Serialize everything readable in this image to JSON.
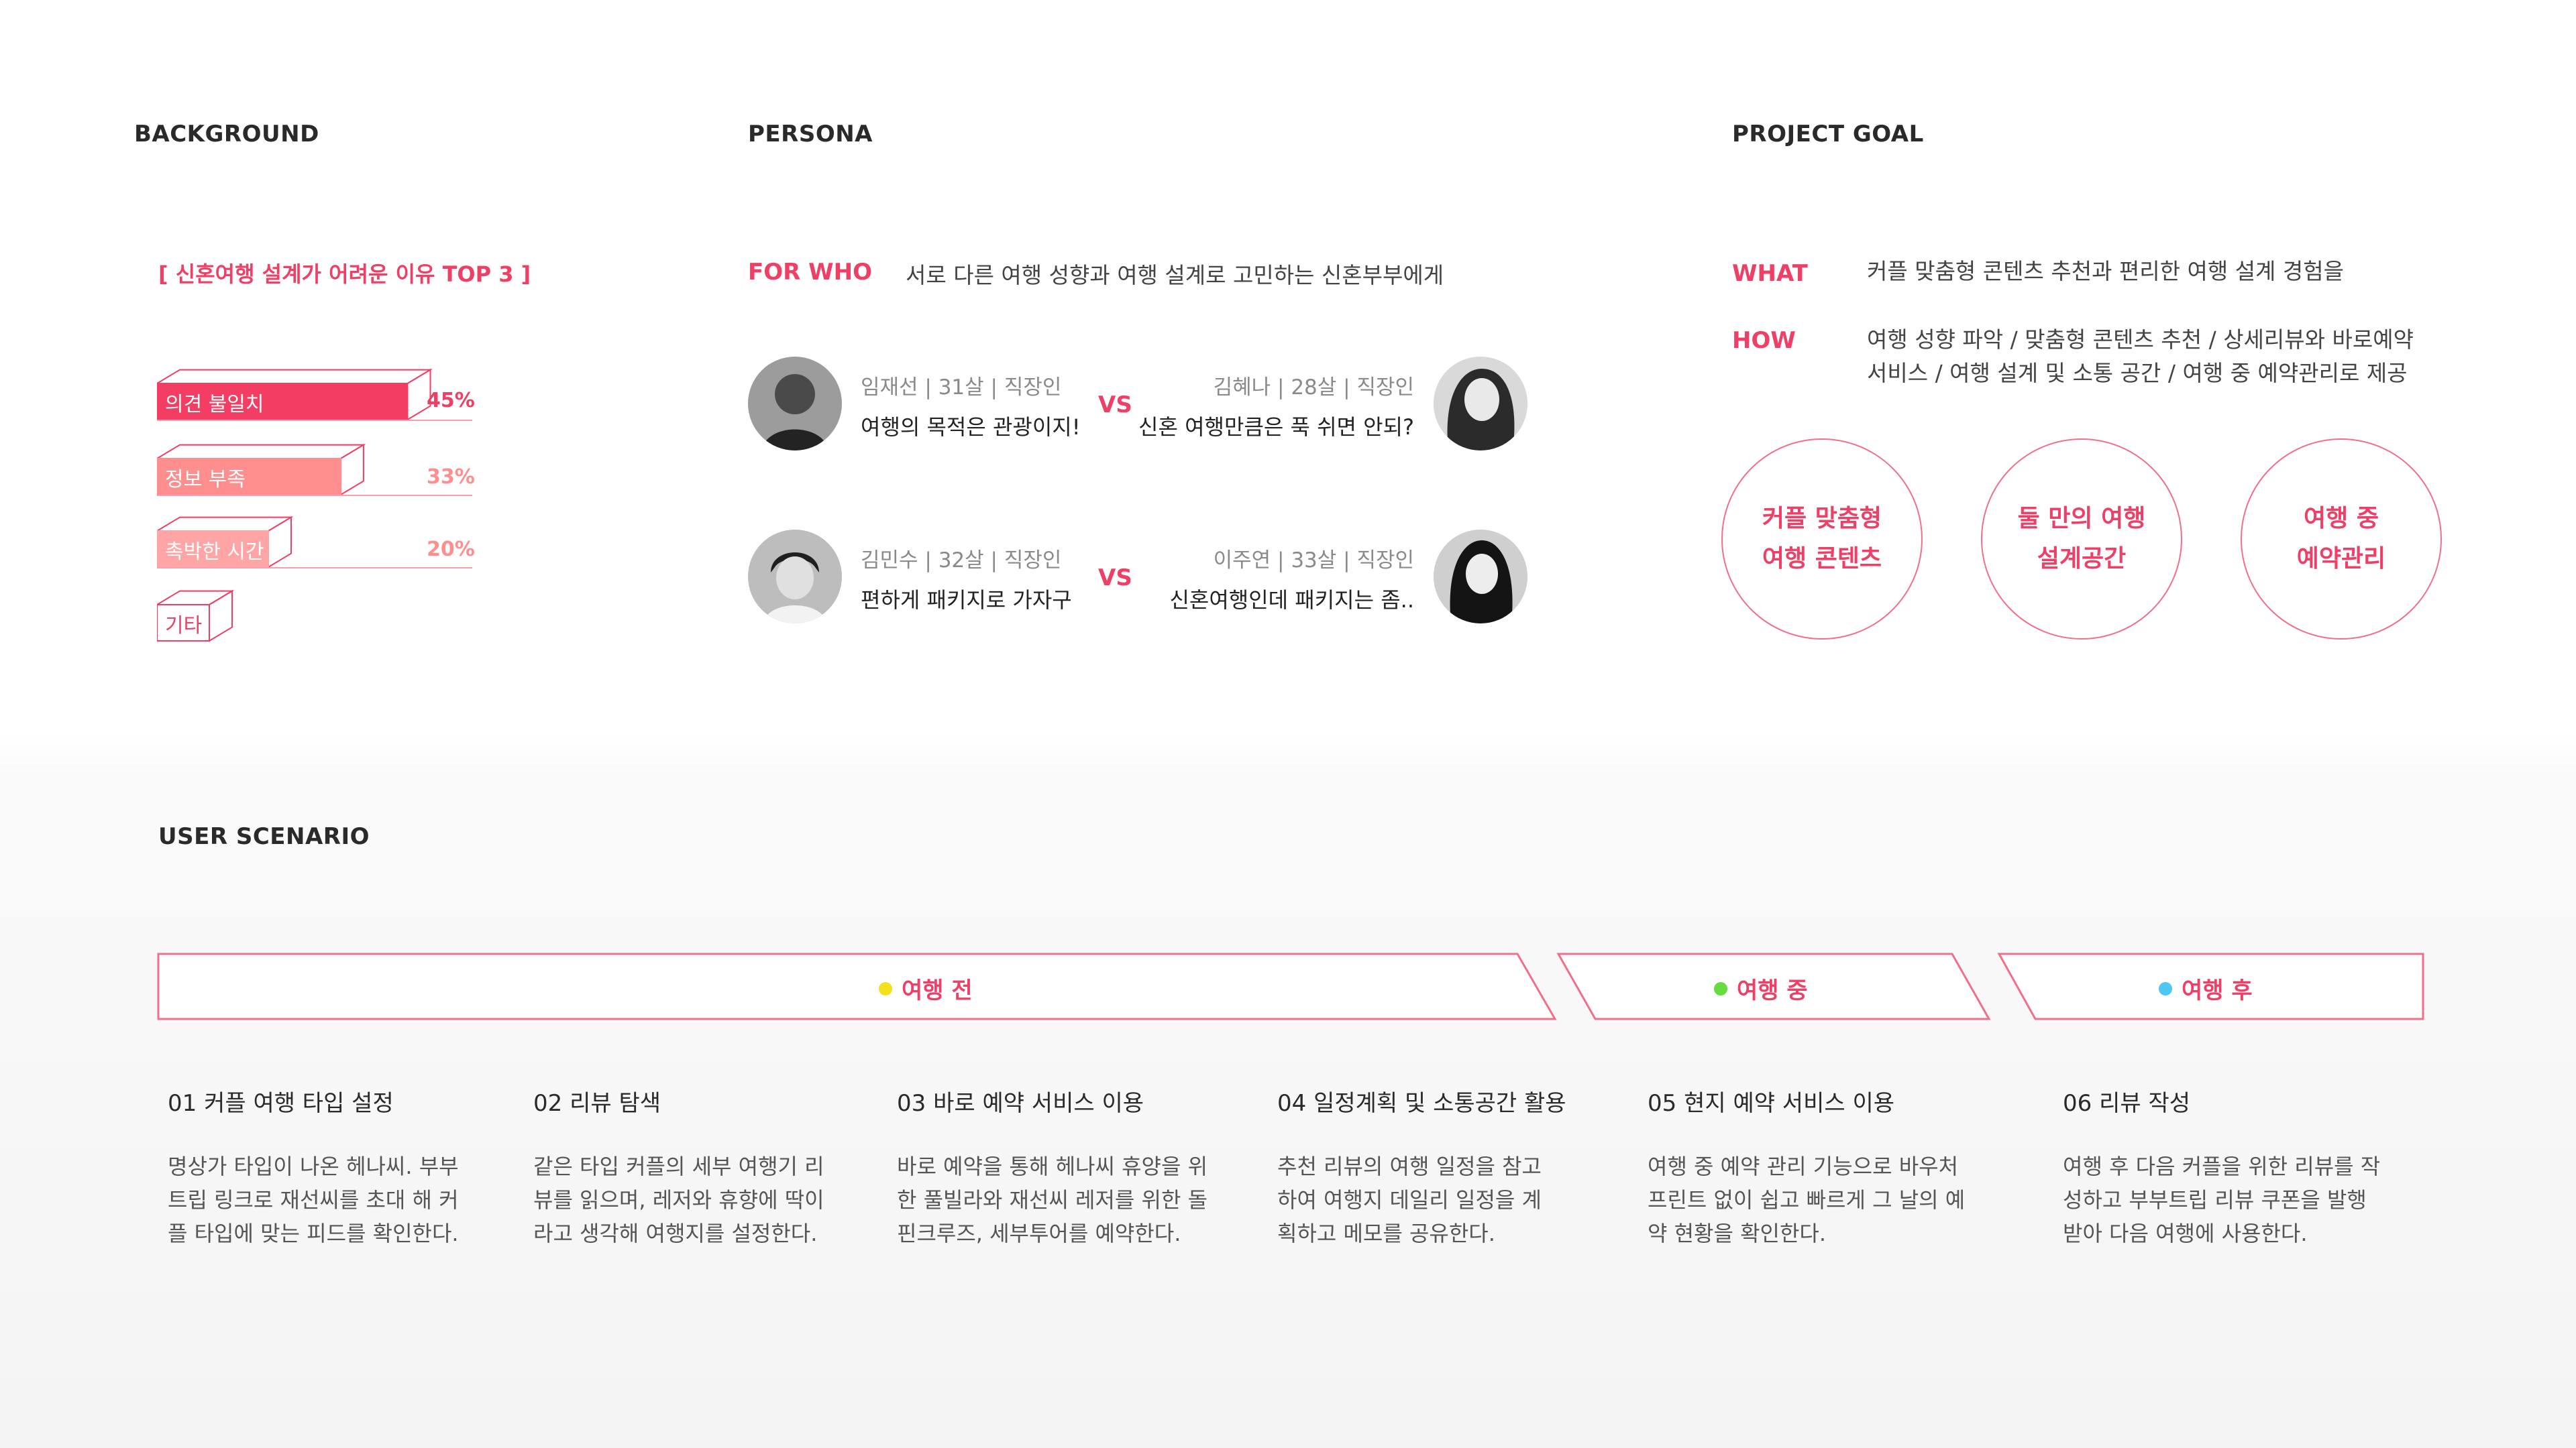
{
  "sections": {
    "background": "BACKGROUND",
    "persona": "PERSONA",
    "goal": "PROJECT GOAL",
    "scenario": "USER SCENARIO"
  },
  "background": {
    "heading": "[ 신혼여행 설계가 어려운 이유 TOP 3 ]",
    "bars": [
      {
        "label": "의견 불일치",
        "percent_text": "45%",
        "value": 45,
        "color": "#f43d62"
      },
      {
        "label": "정보 부족",
        "percent_text": "33%",
        "value": 33,
        "color": "#ff8f8f"
      },
      {
        "label": "촉박한 시간",
        "percent_text": "20%",
        "value": 20,
        "color": "#ffa5a5"
      },
      {
        "label": "기타"
      }
    ]
  },
  "persona": {
    "for_who_label": "FOR WHO",
    "for_who_text": "서로 다른 여행 성향과 여행 설계로 고민하는 신혼부부에게",
    "vs": "VS",
    "pairs": [
      {
        "left": {
          "info": "임재선 | 31살 | 직장인",
          "quote": "여행의 목적은 관광이지!"
        },
        "right": {
          "info": "김혜나 | 28살 | 직장인",
          "quote": "신혼 여행만큼은 푹 쉬면 안되?"
        }
      },
      {
        "left": {
          "info": "김민수 | 32살 | 직장인",
          "quote": "편하게 패키지로 가자구"
        },
        "right": {
          "info": "이주연 | 33살 | 직장인",
          "quote": "신혼여행인데 패키지는 좀.."
        }
      }
    ]
  },
  "goal": {
    "what_label": "WHAT",
    "what_text": "커플 맞춤형 콘텐츠 추천과 편리한 여행 설계 경험을",
    "how_label": "HOW",
    "how_line1": "여행 성향 파악 / 맞춤형 콘텐츠 추천 / 상세리뷰와 바로예약",
    "how_line2": "서비스 / 여행 설계 및 소통 공간 / 여행 중 예약관리로 제공",
    "circles": [
      {
        "line1": "커플 맞춤형",
        "line2": "여행 콘텐츠"
      },
      {
        "line1": "둘 만의 여행",
        "line2": "설계공간"
      },
      {
        "line1": "여행 중",
        "line2": "예약관리"
      }
    ]
  },
  "scenario": {
    "phases": [
      {
        "label": "여행 전",
        "dot_color": "#f5e01f"
      },
      {
        "label": "여행 중",
        "dot_color": "#66dd3c"
      },
      {
        "label": "여행 후",
        "dot_color": "#4cc7f2"
      }
    ],
    "steps": [
      {
        "title": "01 커플 여행 타입 설정",
        "lines": [
          "명상가 타입이 나온 헤나씨. 부부",
          "트립 링크로 재선씨를 초대 해 커",
          "플 타입에 맞는 피드를 확인한다."
        ]
      },
      {
        "title": "02 리뷰 탐색",
        "lines": [
          "같은 타입 커플의 세부 여행기 리",
          "뷰를 읽으며, 레저와 휴향에 딱이",
          "라고 생각해 여행지를 설정한다."
        ]
      },
      {
        "title": "03 바로 예약 서비스 이용",
        "lines": [
          "바로 예약을 통해 헤나씨 휴양을 위",
          "한 풀빌라와 재선씨 레저를 위한 돌",
          "핀크루즈, 세부투어를 예약한다."
        ]
      },
      {
        "title": "04 일정계획 및 소통공간 활용",
        "lines": [
          "추천 리뷰의 여행 일정을 참고",
          "하여 여행지 데일리 일정을 계",
          "획하고 메모를 공유한다."
        ]
      },
      {
        "title": "05 현지 예약 서비스 이용",
        "lines": [
          "여행 중 예약 관리 기능으로 바우처",
          "프린트 없이 쉽고 빠르게 그 날의 예",
          "약 현황을 확인한다."
        ]
      },
      {
        "title": "06 리뷰 작성",
        "lines": [
          "여행 후 다음 커플을 위한 리뷰를 작",
          "성하고 부부트립 리뷰 쿠폰을 발행",
          "받아 다음 여행에 사용한다."
        ]
      }
    ]
  }
}
